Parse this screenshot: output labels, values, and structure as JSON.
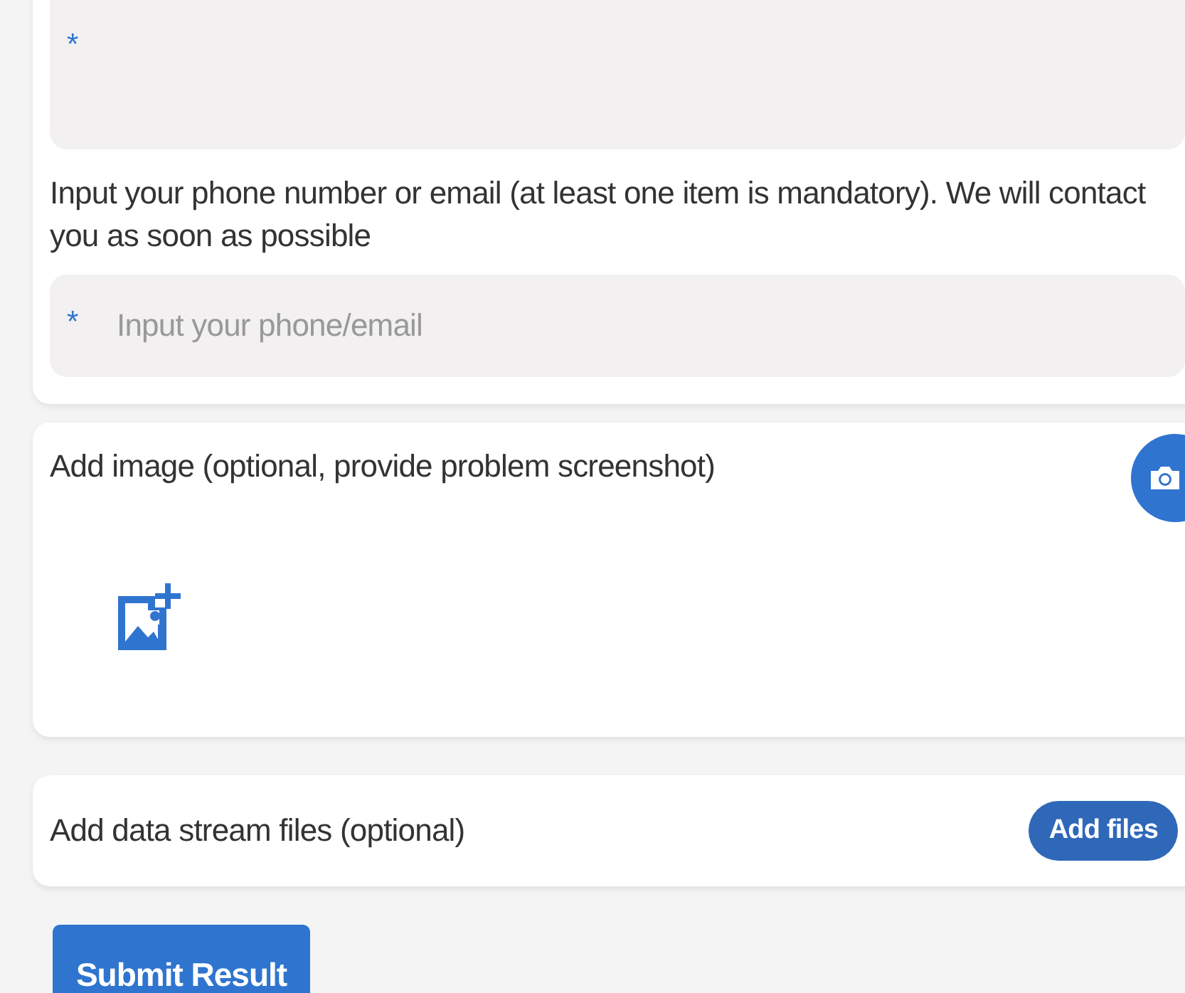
{
  "contact_card": {
    "description_field": {
      "required_mark": "*"
    },
    "contact_prompt": "Input your phone number or email (at least one item is mandatory). We will contact you as soon as possible",
    "contact_field": {
      "required_mark": "*",
      "placeholder": "Input your phone/email"
    }
  },
  "image_card": {
    "label": "Add image (optional, provide problem screenshot)"
  },
  "files_card": {
    "label": "Add data stream files (optional)",
    "button": "Add files"
  },
  "submit_button": "Submit Result"
}
